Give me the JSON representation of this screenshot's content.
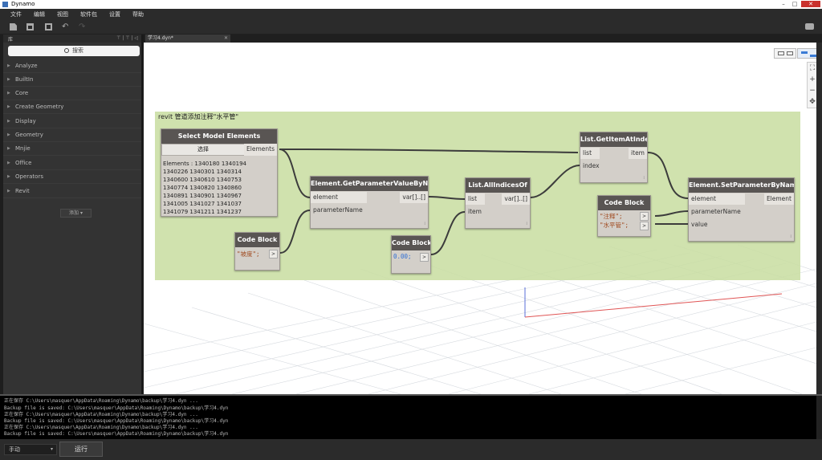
{
  "window": {
    "title": "Dynamo",
    "minimize": "–",
    "maximize": "□",
    "close": "✕"
  },
  "menu": [
    "文件",
    "编辑",
    "视图",
    "软件包",
    "设置",
    "帮助"
  ],
  "library": {
    "header": "库",
    "header_controls": "⊤ | ⊤ | ◁",
    "search_placeholder": "搜索",
    "categories": [
      "Analyze",
      "BuiltIn",
      "Core",
      "Create Geometry",
      "Display",
      "Geometry",
      "Mnjie",
      "Office",
      "Operators",
      "Revit"
    ],
    "add_button": "添加 ▾"
  },
  "tab": {
    "label": "学习4.dyn*",
    "close": "✕"
  },
  "group": {
    "title": "revit 管道添加注释\"水平管\""
  },
  "nodes": {
    "select_model": {
      "title": "Select Model Elements",
      "button": "选择",
      "output": "Elements",
      "elements": [
        "Elements : 1340180 1340194",
        "1340226 1340301 1340314",
        "1340600 1340610 1340753",
        "1340774 1340820 1340860",
        "1340891 1340901 1340967",
        "1341005 1341027 1341037",
        "1341079 1341211 1341237"
      ]
    },
    "get_param": {
      "title": "Element.GetParameterValueByName",
      "in1": "element",
      "in2": "parameterName",
      "out": "var[]..[]",
      "footer": "⁞"
    },
    "code1": {
      "title": "Code Block",
      "code": "\"坡度\";",
      "out": ">"
    },
    "code2": {
      "title": "Code Block",
      "code": "0.00;",
      "out": ">"
    },
    "all_indices": {
      "title": "List.AllIndicesOf",
      "in1": "list",
      "in2": "item",
      "out": "var[]..[]",
      "footer": "⁞"
    },
    "get_item": {
      "title": "List.GetItemAtIndex",
      "in1": "list",
      "in2": "index",
      "out": "item",
      "footer": "⁞"
    },
    "code3": {
      "title": "Code Block",
      "line1": "\"注释\";",
      "line2": "\"水平管\";",
      "out": ">"
    },
    "set_param": {
      "title": "Element.SetParameterByName",
      "in1": "element",
      "in2": "parameterName",
      "in3": "value",
      "out": "Element",
      "footer": "⁞"
    }
  },
  "zoom": {
    "fit": "⛶",
    "in": "+",
    "out": "−",
    "pan": "✥"
  },
  "console": [
    "正在保存 C:\\Users\\masquer\\AppData\\Roaming\\Dynamo\\backup\\学习4.dyn ...",
    "Backup file is saved: C:\\Users\\masquer\\AppData\\Roaming\\Dynamo\\backup\\学习4.dyn",
    "正在保存 C:\\Users\\masquer\\AppData\\Roaming\\Dynamo\\backup\\学习4.dyn ...",
    "Backup file is saved: C:\\Users\\masquer\\AppData\\Roaming\\Dynamo\\backup\\学习4.dyn",
    "正在保存 C:\\Users\\masquer\\AppData\\Roaming\\Dynamo\\backup\\学习4.dyn ...",
    "Backup file is saved: C:\\Users\\masquer\\AppData\\Roaming\\Dynamo\\backup\\学习4.dyn"
  ],
  "footer": {
    "run_mode": "手动",
    "run_mode_arrow": "▾",
    "run_button": "运行"
  },
  "colors": {
    "group": "#c8dda0",
    "node_header": "#595553",
    "node_body": "#d3cfc9",
    "wire": "#3c3c3c"
  }
}
